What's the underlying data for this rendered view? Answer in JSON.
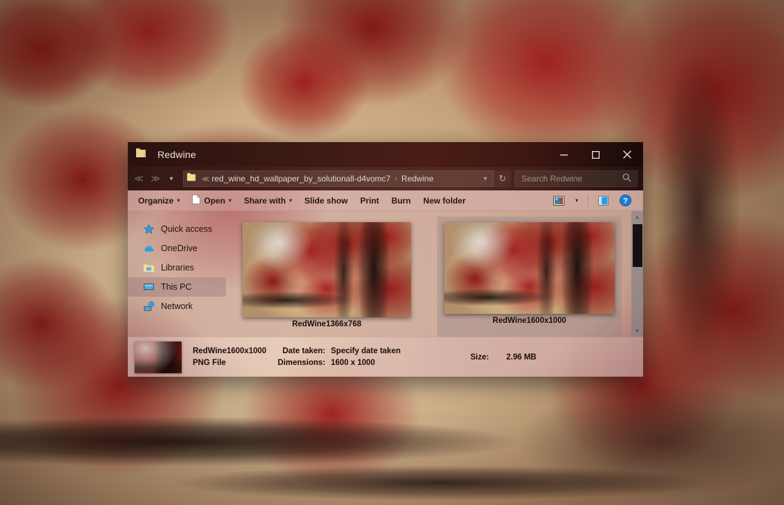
{
  "window": {
    "title": "Redwine",
    "folder_icon": "folder-icon",
    "controls": {
      "minimize": "–",
      "maximize": "□",
      "close": "✕"
    }
  },
  "navbar": {
    "back": "≪",
    "forward": "≫",
    "recent_locations": "▾",
    "breadcrumb": {
      "folder_icon": "folder-icon",
      "overflow": "≪",
      "path_segment": "red_wine_hd_wallpaper_by_solutionall-d4vomc7",
      "separator": "›",
      "current": "Redwine",
      "dropdown": "▾"
    },
    "refresh": "↻",
    "search": {
      "placeholder": "Search Redwine",
      "icon": "search-icon"
    }
  },
  "toolbar": {
    "organize": "Organize",
    "open": "Open",
    "share_with": "Share with",
    "slide_show": "Slide show",
    "print": "Print",
    "burn": "Burn",
    "new_folder": "New folder",
    "caret": "▾",
    "view_options_icon": "picture-view-icon",
    "preview_pane_icon": "preview-pane-icon",
    "help_icon": "help-icon"
  },
  "sidebar": {
    "items": [
      {
        "label": "Quick access",
        "icon": "star-icon",
        "selected": false
      },
      {
        "label": "OneDrive",
        "icon": "cloud-icon",
        "selected": false
      },
      {
        "label": "Libraries",
        "icon": "libraries-folder-icon",
        "selected": false
      },
      {
        "label": "This PC",
        "icon": "monitor-icon",
        "selected": true
      },
      {
        "label": "Network",
        "icon": "network-icon",
        "selected": false
      }
    ]
  },
  "files": [
    {
      "name": "RedWine1366x768",
      "selected": false
    },
    {
      "name": "RedWine1600x1000",
      "selected": true
    }
  ],
  "scrollbar": {
    "up_arrow": "▲",
    "down_arrow": "▼"
  },
  "details": {
    "file_name": "RedWine1600x1000",
    "file_type": "PNG File",
    "date_taken_label": "Date taken:",
    "date_taken_value": "Specify date taken",
    "dimensions_label": "Dimensions:",
    "dimensions_value": "1600 x 1000",
    "size_label": "Size:",
    "size_value": "2.96 MB"
  },
  "colors": {
    "titlebar": "#3a1a14",
    "toolbar": "#d1aaa6",
    "accent_help": "#1a7fd4",
    "selection": "#9e8c8c"
  }
}
